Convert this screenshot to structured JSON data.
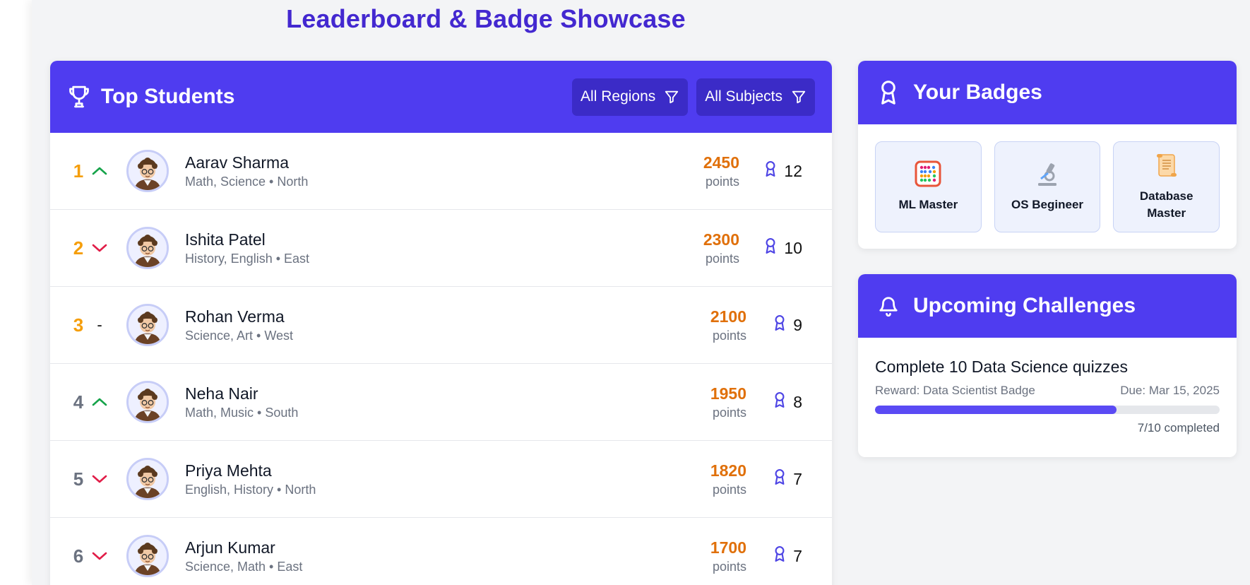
{
  "page": {
    "title": "Leaderboard & Badge Showcase"
  },
  "leaderboard": {
    "title": "Top Students",
    "icon": "trophy-icon",
    "filters": [
      {
        "label": "All Regions",
        "icon": "filter-icon"
      },
      {
        "label": "All Subjects",
        "icon": "filter-icon"
      }
    ],
    "points_label": "points",
    "students": [
      {
        "rank": "1",
        "trend": "up",
        "name": "Aarav Sharma",
        "meta": "Math, Science • North",
        "points": "2450",
        "badges": "12"
      },
      {
        "rank": "2",
        "trend": "down",
        "name": "Ishita Patel",
        "meta": "History, English • East",
        "points": "2300",
        "badges": "10"
      },
      {
        "rank": "3",
        "trend": "none",
        "trend_text": "-",
        "name": "Rohan Verma",
        "meta": "Science, Art • West",
        "points": "2100",
        "badges": "9"
      },
      {
        "rank": "4",
        "trend": "up",
        "name": "Neha Nair",
        "meta": "Math, Music • South",
        "points": "1950",
        "badges": "8"
      },
      {
        "rank": "5",
        "trend": "down",
        "name": "Priya Mehta",
        "meta": "English, History • North",
        "points": "1820",
        "badges": "7"
      },
      {
        "rank": "6",
        "trend": "down",
        "name": "Arjun Kumar",
        "meta": "Science, Math • East",
        "points": "1700",
        "badges": "7"
      }
    ]
  },
  "badges": {
    "title": "Your Badges",
    "icon": "award-icon",
    "items": [
      {
        "name": "ML Master",
        "icon": "abacus-icon"
      },
      {
        "name": "OS Begineer",
        "icon": "microscope-icon"
      },
      {
        "name": "Database Master",
        "icon": "scroll-icon"
      }
    ]
  },
  "challenges": {
    "title": "Upcoming Challenges",
    "icon": "bell-icon",
    "items": [
      {
        "title": "Complete 10 Data Science quizzes",
        "reward": "Reward: Data Scientist Badge",
        "due": "Due: Mar 15, 2025",
        "progress_fraction": 0.7,
        "progress_text": "7/10 completed"
      }
    ]
  },
  "colors": {
    "primary": "#4f3cf0",
    "title": "#4328d0",
    "rank_top3": "#f59e0b",
    "rank_other": "#6b7280",
    "points": "#e0700a",
    "trend_up": "#16a34a",
    "trend_down": "#e11d48",
    "badge_icon": "#4f46e5"
  }
}
